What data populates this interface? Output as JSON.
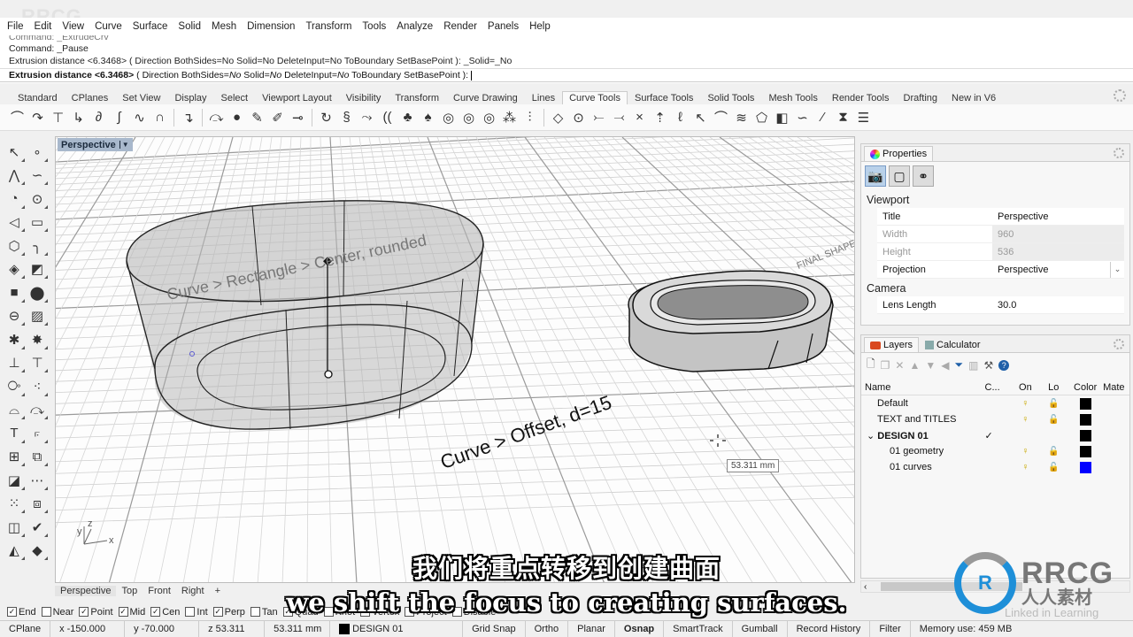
{
  "menu": [
    "File",
    "Edit",
    "View",
    "Curve",
    "Surface",
    "Solid",
    "Mesh",
    "Dimension",
    "Transform",
    "Tools",
    "Analyze",
    "Render",
    "Panels",
    "Help"
  ],
  "watermark": "RRCG",
  "command_history": [
    "Command: _ExtrudeCrv",
    "Command: _Pause",
    "Extrusion distance <6.3468> ( Direction  BothSides=No  Solid=No  DeleteInput=No  ToBoundary  SetBasePoint ): _Solid=_No"
  ],
  "command_prompt": {
    "label": "Extrusion distance <6.3468>",
    "options_open": " ( Direction  BothSides=",
    "bothsides": "No",
    "solid_label": "  Solid=",
    "solid": "No",
    "delete_label": "  DeleteInput=",
    "delete": "No",
    "rest": "  ToBoundary  SetBasePoint ): "
  },
  "toolbar_tabs": [
    {
      "label": "Standard",
      "active": false
    },
    {
      "label": "CPlanes",
      "active": false
    },
    {
      "label": "Set View",
      "active": false
    },
    {
      "label": "Display",
      "active": false
    },
    {
      "label": "Select",
      "active": false
    },
    {
      "label": "Viewport Layout",
      "active": false
    },
    {
      "label": "Visibility",
      "active": false
    },
    {
      "label": "Transform",
      "active": false
    },
    {
      "label": "Curve Drawing",
      "active": false
    },
    {
      "label": "Lines",
      "active": false
    },
    {
      "label": "Curve Tools",
      "active": true
    },
    {
      "label": "Surface Tools",
      "active": false
    },
    {
      "label": "Solid Tools",
      "active": false
    },
    {
      "label": "Mesh Tools",
      "active": false
    },
    {
      "label": "Render Tools",
      "active": false
    },
    {
      "label": "Drafting",
      "active": false
    },
    {
      "label": "New in V6",
      "active": false
    }
  ],
  "toolbar_icons": [
    {
      "name": "fillet-curves-icon",
      "glyph": "⌒"
    },
    {
      "name": "blend-curves-icon",
      "glyph": "↷"
    },
    {
      "name": "adjust-curve-end-bulge-icon",
      "glyph": "⊤"
    },
    {
      "name": "chamfer-curves-icon",
      "glyph": "↳"
    },
    {
      "name": "match-curve-icon",
      "glyph": "∂"
    },
    {
      "name": "curve-from-2-views-icon",
      "glyph": "∫"
    },
    {
      "name": "adjust-seam-icon",
      "glyph": "∿"
    },
    {
      "name": "arch-curve-icon",
      "glyph": "∩"
    },
    {
      "name": "sep",
      "glyph": ""
    },
    {
      "name": "offset-curve-icon",
      "glyph": "↴"
    },
    {
      "name": "sep",
      "glyph": ""
    },
    {
      "name": "curve-edit-icon",
      "glyph": "⤼"
    },
    {
      "name": "join-icon",
      "glyph": "●"
    },
    {
      "name": "explode-icon",
      "glyph": "✎"
    },
    {
      "name": "extend-icon",
      "glyph": "✐"
    },
    {
      "name": "extend-line-icon",
      "glyph": "⊸"
    },
    {
      "name": "sep",
      "glyph": ""
    },
    {
      "name": "close-curve-icon",
      "glyph": "↻"
    },
    {
      "name": "curve-boolean-icon",
      "glyph": "§"
    },
    {
      "name": "flow-icon",
      "glyph": "⤳"
    },
    {
      "name": "rebuild-icon",
      "glyph": "(("
    },
    {
      "name": "simplify-icon",
      "glyph": "♣"
    },
    {
      "name": "refit-icon",
      "glyph": "♠"
    },
    {
      "name": "fit-icon",
      "glyph": "◎"
    },
    {
      "name": "dec-icon",
      "glyph": "◎"
    },
    {
      "name": "fair-icon",
      "glyph": "◎"
    },
    {
      "name": "points-icon",
      "glyph": "⁂"
    },
    {
      "name": "insert-knot-icon",
      "glyph": "⫶"
    },
    {
      "name": "sep",
      "glyph": ""
    },
    {
      "name": "polyline-icon",
      "glyph": "◇"
    },
    {
      "name": "control-points-icon",
      "glyph": "⊙"
    },
    {
      "name": "insert-point-icon",
      "glyph": "⤚"
    },
    {
      "name": "insert-edit-point-icon",
      "glyph": "⤙"
    },
    {
      "name": "remove-knot-icon",
      "glyph": "×"
    },
    {
      "name": "move-point-icon",
      "glyph": "⇡"
    },
    {
      "name": "handlebar-icon",
      "glyph": "ℓ"
    },
    {
      "name": "kink-icon",
      "glyph": "↖"
    },
    {
      "name": "arc-icon",
      "glyph": "⌒"
    },
    {
      "name": "smooth-icon",
      "glyph": "≋"
    },
    {
      "name": "project-icon",
      "glyph": "⬠"
    },
    {
      "name": "pull-icon",
      "glyph": "◧"
    },
    {
      "name": "curve-tangent-icon",
      "glyph": "∽"
    },
    {
      "name": "line-from-curve-icon",
      "glyph": "⁄"
    },
    {
      "name": "fold-icon",
      "glyph": "⧗"
    },
    {
      "name": "hatch-lines-icon",
      "glyph": "☰"
    }
  ],
  "left_tools": {
    "col1": [
      {
        "name": "select-arrow-icon",
        "glyph": "↖"
      },
      {
        "name": "polyline-icon",
        "glyph": "⋀"
      },
      {
        "name": "circle-icon",
        "glyph": "◔"
      },
      {
        "name": "arc-icon",
        "glyph": "◁"
      },
      {
        "name": "polygon-icon",
        "glyph": "⬡"
      },
      {
        "name": "surface-from-points-icon",
        "glyph": "◈"
      },
      {
        "name": "box-icon",
        "glyph": "■"
      },
      {
        "name": "extrude-icon",
        "glyph": "⊖"
      },
      {
        "name": "explode-icon",
        "glyph": "✱"
      },
      {
        "name": "cplane-icon",
        "glyph": "⊥"
      },
      {
        "name": "boolean-union-icon",
        "glyph": "⧂"
      },
      {
        "name": "fillet-edge-icon",
        "glyph": "⌓"
      },
      {
        "name": "text-icon",
        "glyph": "T"
      },
      {
        "name": "group-icon",
        "glyph": "⊞"
      },
      {
        "name": "block-icon",
        "glyph": "◪"
      },
      {
        "name": "array-icon",
        "glyph": "⁙"
      },
      {
        "name": "layout-icon",
        "glyph": "◫"
      },
      {
        "name": "shade-icon",
        "glyph": "◭"
      }
    ],
    "col2": [
      {
        "name": "point-icon",
        "glyph": "∘"
      },
      {
        "name": "control-point-curve-icon",
        "glyph": "∽"
      },
      {
        "name": "ellipse-icon",
        "glyph": "⊙"
      },
      {
        "name": "rectangle-icon",
        "glyph": "▭"
      },
      {
        "name": "curve-fillet-icon",
        "glyph": "╮"
      },
      {
        "name": "surface-icon",
        "glyph": "◩"
      },
      {
        "name": "sphere-icon",
        "glyph": "⬤"
      },
      {
        "name": "mesh-icon",
        "glyph": "▨"
      },
      {
        "name": "split-icon",
        "glyph": "✸"
      },
      {
        "name": "set-cplane-icon",
        "glyph": "⊤"
      },
      {
        "name": "boolean-difference-icon",
        "glyph": "⁖"
      },
      {
        "name": "curve-handle-icon",
        "glyph": "⤼"
      },
      {
        "name": "dimension-icon",
        "glyph": "⟔"
      },
      {
        "name": "scale-icon",
        "glyph": "⧉"
      },
      {
        "name": "dims-linear-icon",
        "glyph": "⋯"
      },
      {
        "name": "join-icon",
        "glyph": "⧈"
      },
      {
        "name": "analyze-icon",
        "glyph": "✔"
      },
      {
        "name": "render-icon",
        "glyph": "◆"
      }
    ]
  },
  "viewport": {
    "title": "Perspective",
    "annotations": [
      {
        "text": "Curve > Rectangle > Center, rounded"
      },
      {
        "text": "Curve > Offset, d=15"
      },
      {
        "text": "FINAL SHAPE / Mat..."
      }
    ],
    "dimension_tooltip": "53.311 mm",
    "axes": {
      "x": "x",
      "y": "y",
      "z": "z"
    }
  },
  "viewport_tabs": [
    {
      "label": "Perspective",
      "active": true
    },
    {
      "label": "Top",
      "active": false
    },
    {
      "label": "Front",
      "active": false
    },
    {
      "label": "Right",
      "active": false
    },
    {
      "label": "+",
      "active": false
    }
  ],
  "osnap": [
    {
      "label": "End",
      "checked": true
    },
    {
      "label": "Near",
      "checked": false
    },
    {
      "label": "Point",
      "checked": true
    },
    {
      "label": "Mid",
      "checked": true
    },
    {
      "label": "Cen",
      "checked": true
    },
    {
      "label": "Int",
      "checked": false
    },
    {
      "label": "Perp",
      "checked": true
    },
    {
      "label": "Tan",
      "checked": false
    },
    {
      "label": "Quad",
      "checked": true
    },
    {
      "label": "Knot",
      "checked": false
    },
    {
      "label": "Vertex",
      "checked": false
    },
    {
      "label": "Project",
      "checked": false
    },
    {
      "label": "Disable",
      "checked": false
    }
  ],
  "status": {
    "cplane": "CPlane",
    "x": "x -150.000",
    "y": "y -70.000",
    "z": "z 53.311",
    "distance": "53.311 mm",
    "layer": "DESIGN 01",
    "toggles": [
      {
        "label": "Grid Snap",
        "active": false
      },
      {
        "label": "Ortho",
        "active": false
      },
      {
        "label": "Planar",
        "active": false
      },
      {
        "label": "Osnap",
        "active": true
      },
      {
        "label": "SmartTrack",
        "active": false
      },
      {
        "label": "Gumball",
        "active": false
      },
      {
        "label": "Record History",
        "active": false
      },
      {
        "label": "Filter",
        "active": false
      }
    ],
    "memory": "Memory use: 459 MB"
  },
  "properties": {
    "tab": "Properties",
    "section_viewport": "Viewport",
    "rows": [
      {
        "key": "Title",
        "value": "Perspective",
        "disabled": false,
        "dropdown": false
      },
      {
        "key": "Width",
        "value": "960",
        "disabled": true,
        "dropdown": false
      },
      {
        "key": "Height",
        "value": "536",
        "disabled": true,
        "dropdown": false
      },
      {
        "key": "Projection",
        "value": "Perspective",
        "disabled": false,
        "dropdown": true
      }
    ],
    "section_camera": "Camera",
    "camera_rows": [
      {
        "key": "Lens Length",
        "value": "30.0"
      }
    ]
  },
  "layers": {
    "tabs": [
      "Layers",
      "Calculator"
    ],
    "columns": [
      "Name",
      "C...",
      "On",
      "Lo",
      "Color",
      "Mate"
    ],
    "rows": [
      {
        "name": "Default",
        "current": false,
        "on": true,
        "locked": true,
        "color": "#000000",
        "indent": 1,
        "bold": false,
        "expander": false
      },
      {
        "name": "TEXT and TITLES",
        "current": false,
        "on": true,
        "locked": true,
        "color": "#000000",
        "indent": 1,
        "bold": false,
        "expander": false
      },
      {
        "name": "DESIGN 01",
        "current": true,
        "on": false,
        "locked": false,
        "color": "#000000",
        "indent": 0,
        "bold": true,
        "expander": true
      },
      {
        "name": "01 geometry",
        "current": false,
        "on": true,
        "locked": true,
        "color": "#000000",
        "indent": 2,
        "bold": false,
        "expander": false
      },
      {
        "name": "01 curves",
        "current": false,
        "on": true,
        "locked": true,
        "color": "#0000ff",
        "indent": 2,
        "bold": false,
        "expander": false
      }
    ]
  },
  "subtitles": {
    "chinese": "我们将重点转移到创建曲面",
    "english": "we shift the focus to creating surfaces."
  },
  "logo": {
    "brand": "RRCG",
    "brand_cn": "人人素材",
    "linkedin": "Linked in Learning"
  }
}
